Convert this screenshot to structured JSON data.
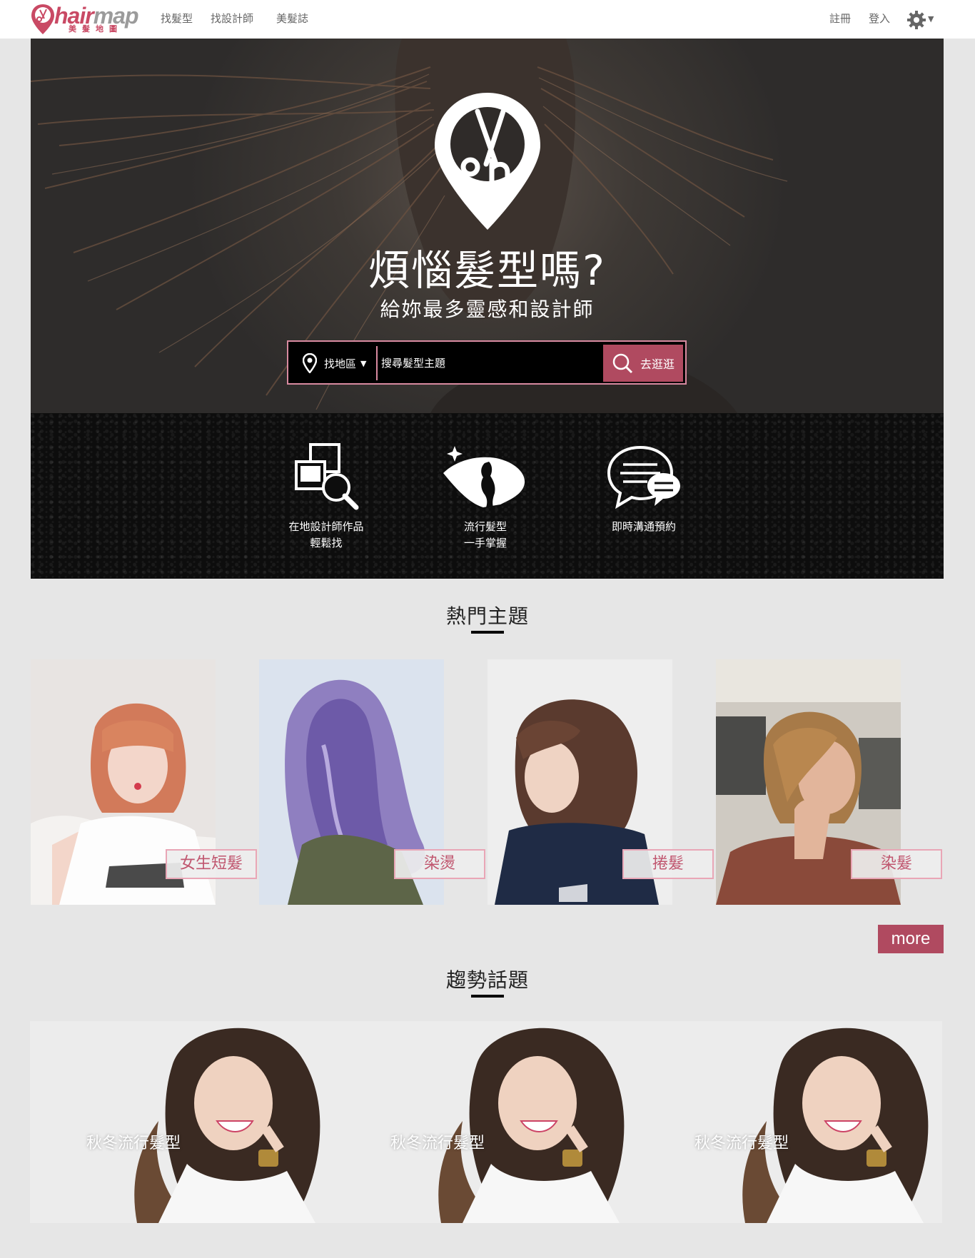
{
  "nav": {
    "logo_word_a": "hair",
    "logo_word_b": "map",
    "logo_sub": "美髮地圖",
    "links": [
      "找髮型",
      "找設計師",
      "美髮誌"
    ],
    "register": "註冊",
    "login": "登入",
    "settings_icon": "gear-icon"
  },
  "hero": {
    "title": "煩惱髮型嗎?",
    "subtitle": "給妳最多靈感和設計師",
    "search": {
      "area_label": "找地區",
      "placeholder": "搜尋髮型主題",
      "button_label": "去逛逛"
    }
  },
  "features": [
    {
      "icon": "search-portfolio-icon",
      "line1": "在地設計師作品",
      "line2": "輕鬆找"
    },
    {
      "icon": "hair-trend-icon",
      "line1": "流行髮型",
      "line2": "一手掌握"
    },
    {
      "icon": "chat-bubble-icon",
      "line1": "即時溝通預約",
      "line2": ""
    }
  ],
  "hot_topics": {
    "title": "熱門主題",
    "items": [
      {
        "label": "女生短髮"
      },
      {
        "label": "染燙"
      },
      {
        "label": "捲髮"
      },
      {
        "label": "染髮"
      }
    ],
    "more_label": "more"
  },
  "trends": {
    "title": "趨勢話題",
    "items": [
      {
        "label": "秋冬流行髮型"
      },
      {
        "label": "秋冬流行髮型"
      },
      {
        "label": "秋冬流行髮型"
      }
    ]
  },
  "colors": {
    "brand_pink": "#c94964",
    "button_rose": "#b04a60",
    "label_border": "#e9a6b6",
    "page_bg": "#e6e6e6"
  }
}
